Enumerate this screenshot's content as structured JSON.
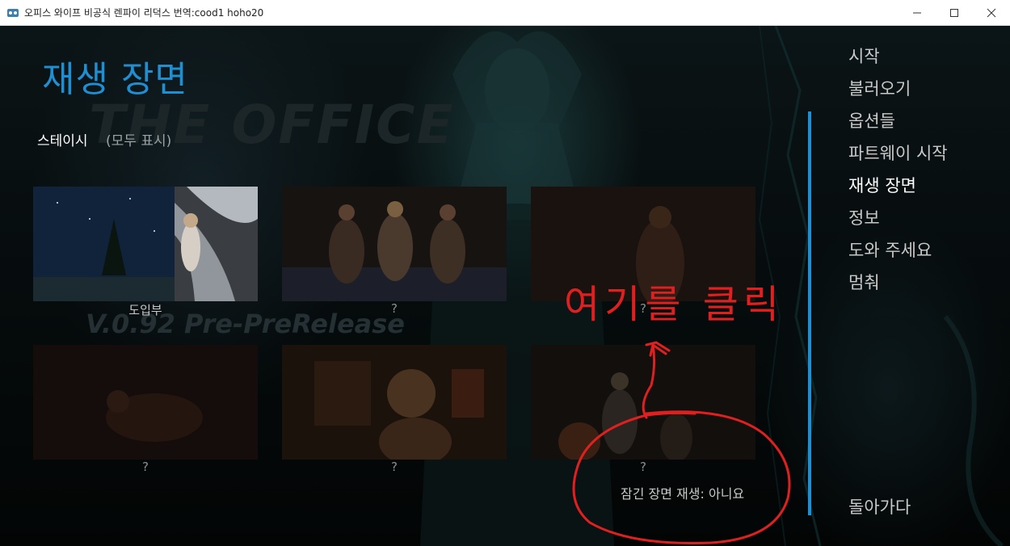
{
  "window": {
    "title": "오피스 와이프 비공식 렌파이 리덕스  번역:cood1 hoho20",
    "minimize_icon": "minimize-icon",
    "maximize_icon": "maximize-icon",
    "close_icon": "close-icon"
  },
  "background_watermark": {
    "brand": "THE OFFICE",
    "version": "V.0.92 Pre-PreRelease"
  },
  "screen": {
    "title": "재생 장면",
    "category": "스테이시",
    "show_all": "(모두 표시)"
  },
  "scenes": [
    {
      "label": "도입부",
      "locked": false
    },
    {
      "label": "?",
      "locked": true
    },
    {
      "label": "?",
      "locked": true
    },
    {
      "label": "?",
      "locked": true
    },
    {
      "label": "?",
      "locked": true
    },
    {
      "label": "?",
      "locked": true
    }
  ],
  "locked_toggle": "잠긴 장면 재생: 아니요",
  "menu": [
    {
      "label": "시작",
      "active": false
    },
    {
      "label": "불러오기",
      "active": false
    },
    {
      "label": "옵션들",
      "active": false
    },
    {
      "label": "파트웨이 시작",
      "active": false
    },
    {
      "label": "재생 장면",
      "active": true
    },
    {
      "label": "정보",
      "active": false
    },
    {
      "label": "도와 주세요",
      "active": false
    },
    {
      "label": "멈춰",
      "active": false
    }
  ],
  "back": "돌아가다",
  "annotation": {
    "text": "여기를 클릭",
    "color": "#e02020"
  },
  "colors": {
    "accent": "#1f8fd2",
    "menu_text": "#c9c9c9",
    "active_text": "#ffffff"
  }
}
